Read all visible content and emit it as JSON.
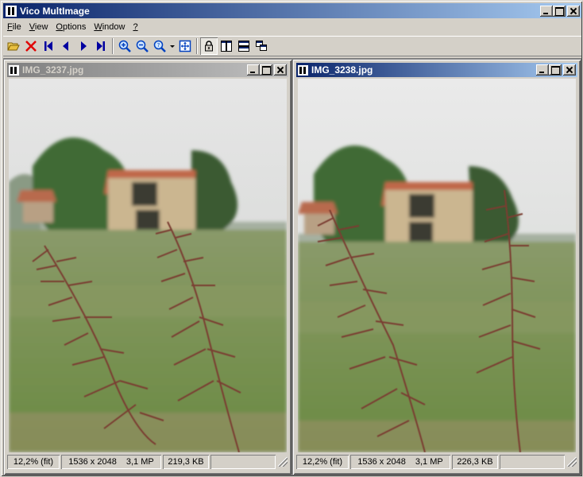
{
  "window": {
    "title": "Vico MultImage",
    "icon": "app-icon"
  },
  "menu": [
    {
      "label": "File",
      "accel": "F",
      "rest": "ile"
    },
    {
      "label": "View",
      "accel": "V",
      "rest": "iew"
    },
    {
      "label": "Options",
      "accel": "O",
      "rest": "ptions"
    },
    {
      "label": "Window",
      "accel": "W",
      "rest": "indow"
    },
    {
      "label": "?",
      "accel": "?",
      "rest": ""
    }
  ],
  "toolbar": [
    {
      "name": "open-folder-icon",
      "color": "#e8c040"
    },
    {
      "name": "close-red-x-icon",
      "color": "#e00000"
    },
    {
      "name": "first-image-icon",
      "color": "#0000a0"
    },
    {
      "name": "previous-image-icon",
      "color": "#0000a0"
    },
    {
      "name": "next-image-icon",
      "color": "#0000a0"
    },
    {
      "name": "last-image-icon",
      "color": "#0000a0"
    },
    {
      "name": "zoom-in-icon",
      "color": "#0040c0"
    },
    {
      "name": "zoom-out-icon",
      "color": "#0040c0"
    },
    {
      "name": "zoom-menu-icon",
      "color": "#0040c0"
    },
    {
      "name": "fit-to-window-icon",
      "color": "#0040c0"
    },
    {
      "name": "lock-sync-icon",
      "color": "#000000",
      "pressed": true
    },
    {
      "name": "tile-vertical-icon",
      "color": "#000000"
    },
    {
      "name": "tile-horizontal-icon",
      "color": "#000000"
    },
    {
      "name": "cascade-icon",
      "color": "#000000"
    }
  ],
  "images": [
    {
      "title": "IMG_3237.jpg",
      "active": false,
      "zoom": "12,2% (fit)",
      "dimensions": "1536 x 2048",
      "megapixels": "3,1 MP",
      "filesize": "219,3 KB"
    },
    {
      "title": "IMG_3238.jpg",
      "active": true,
      "zoom": "12,2% (fit)",
      "dimensions": "1536 x 2048",
      "megapixels": "3,1 MP",
      "filesize": "226,3 KB"
    }
  ],
  "colors": {
    "active_title": "#0a246a",
    "inactive_title": "#808080",
    "face": "#d4d0c8",
    "sky": "#dcdcda",
    "field": "#8a9a62",
    "roof": "#c46a48",
    "wall": "#c9b48c",
    "tree": "#4a6a38",
    "grass_stalk": "#8a4a3a"
  }
}
